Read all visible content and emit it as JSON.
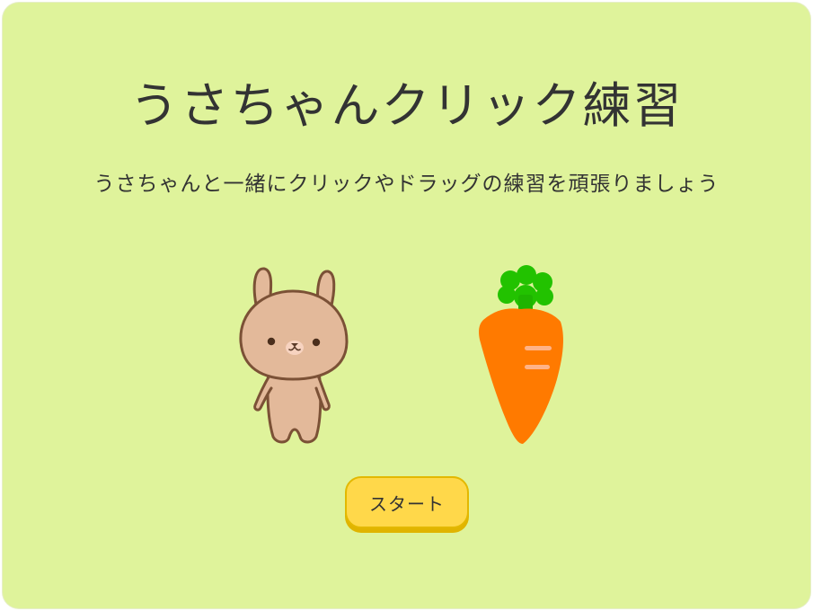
{
  "page": {
    "title": "うさちゃんクリック練習",
    "subtitle": "うさちゃんと一緒にクリックやドラッグの練習を頑張りましょう"
  },
  "controls": {
    "start_label": "スタート"
  },
  "colors": {
    "background": "#dff39b",
    "button": "#ffd84a",
    "bunny_fur": "#e3b99a",
    "carrot_body": "#ff7a00",
    "carrot_leaves": "#22c200"
  }
}
